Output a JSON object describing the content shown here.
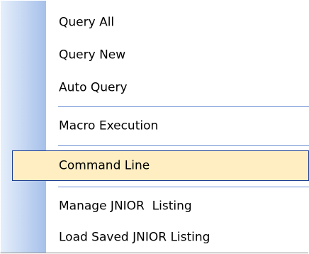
{
  "menu": {
    "items": [
      {
        "label": "Query All"
      },
      {
        "label": "Query New"
      },
      {
        "label": "Auto Query"
      },
      {
        "label": "Macro Execution"
      },
      {
        "label": "Command Line",
        "highlighted": true
      },
      {
        "label": "Manage JNIOR  Listing"
      },
      {
        "label": "Load Saved JNIOR Listing"
      }
    ]
  },
  "colors": {
    "gutter_light": "#e6effb",
    "gutter_dark": "#a6c0ea",
    "separator": "#6b8fd1",
    "highlight_fill": "#ffeec2",
    "highlight_border": "#1c3f93"
  }
}
